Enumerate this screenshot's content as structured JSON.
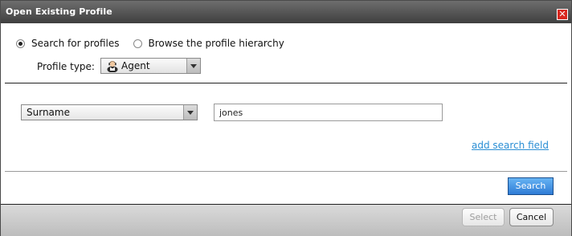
{
  "dialog": {
    "title": "Open Existing Profile",
    "close_glyph": "✕"
  },
  "mode": {
    "options": [
      {
        "label": "Search for profiles",
        "selected": true
      },
      {
        "label": "Browse the profile hierarchy",
        "selected": false
      }
    ]
  },
  "profile_type": {
    "label": "Profile type:",
    "value": "Agent",
    "icon": "agent-person-icon"
  },
  "search_row": {
    "field": "Surname",
    "value": "jones"
  },
  "add_field_link": "add search field",
  "search_button": "Search",
  "footer": {
    "select_label": "Select",
    "cancel_label": "Cancel"
  },
  "colors": {
    "link": "#2a8ed4",
    "primary_button": "#2f7cd6",
    "close_button": "#d9271e"
  }
}
